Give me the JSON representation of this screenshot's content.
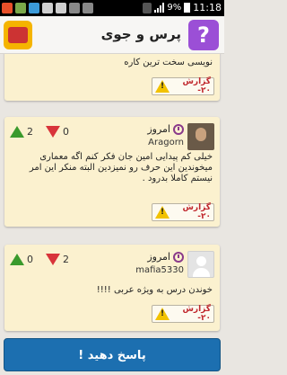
{
  "status_bar": {
    "battery_percent": "9%",
    "time": "11:18",
    "notification_icons": [
      "kik-icon",
      "image-icon",
      "sms-icon",
      "email-icon",
      "email-icon",
      "usb-icon",
      "debug-icon"
    ]
  },
  "header": {
    "title": "پرس و جوی",
    "help_icon": "?",
    "logo_icon": "app-logo-icon"
  },
  "posts": [
    {
      "body": "نویسی سخت ترین کاره",
      "report_label": "گزارش ۲۰-",
      "partial": true
    },
    {
      "date": "امروز",
      "username": "Aragorn",
      "upvotes": "2",
      "downvotes": "0",
      "body": "خیلی کم پیدایی امین جان فکر کنم اگه معماری میخوندین این حرف رو نمیزدین البته منکر این امر نیستم کاملا بدرود .",
      "report_label": "گزارش ۲۰-"
    },
    {
      "date": "امروز",
      "username": "mafia5330",
      "upvotes": "0",
      "downvotes": "2",
      "body": "خوندن درس به ویژه عربی !!!!",
      "report_label": "گزارش ۲۰-"
    }
  ],
  "answer_button": "پاسخ دهید !",
  "colors": {
    "accent": "#1c6fb0",
    "card": "#fbf1cf",
    "help": "#9b4fd6",
    "upvote": "#3a9a2c",
    "downvote": "#d8343a"
  }
}
